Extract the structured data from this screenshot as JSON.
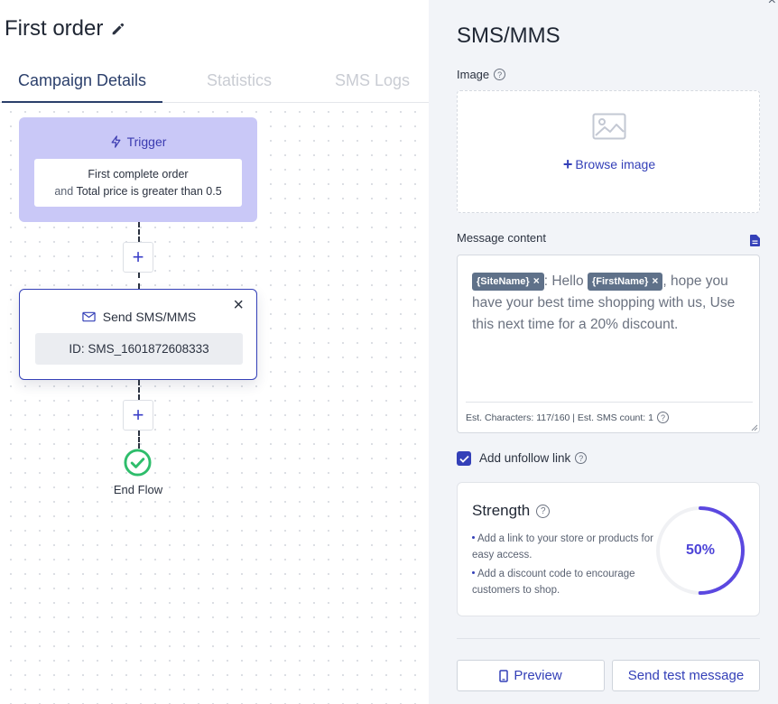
{
  "left": {
    "title": "First order",
    "tabs": [
      {
        "label": "Campaign Details",
        "active": true
      },
      {
        "label": "Statistics",
        "active": false
      },
      {
        "label": "SMS Logs",
        "active": false
      }
    ]
  },
  "flow": {
    "trigger": {
      "title": "Trigger",
      "line1": "First complete order",
      "line2_prefix": "and",
      "line2": "Total price is greater than 0.5"
    },
    "plus_label": "+",
    "sms_node": {
      "title": "Send SMS/MMS",
      "id_text": "ID: SMS_1601872608333",
      "close_label": "×"
    },
    "end": {
      "label": "End Flow"
    }
  },
  "panel": {
    "title": "SMS/MMS",
    "corner_close": "×",
    "image_label": "Image",
    "browse_label": "Browse image",
    "browse_plus": "+",
    "message_label": "Message content",
    "message": {
      "tag1": "{SiteName}",
      "text1": ": Hello",
      "tag2": "{FirstName}",
      "text2": ", hope you have your best time shopping with us, Use this  next time for a 20% discount.",
      "tag_remove": "×"
    },
    "est_text": "Est. Characters: 117/160 | Est. SMS count: 1",
    "unfollow_label": "Add unfollow link",
    "unfollow_checked": true,
    "help_glyph": "?",
    "strength": {
      "title": "Strength",
      "tips": [
        "Add a link to your store or products for easy access.",
        "Add a discount code to encourage customers to shop."
      ],
      "value_percent": 50,
      "value_label": "50%"
    },
    "buttons": {
      "preview": "Preview",
      "send_test": "Send test message"
    }
  },
  "colors": {
    "accent": "#3440b8",
    "trigger_bg": "#c9c8f7",
    "gauge": "#5b48e0",
    "success": "#2ebd6b"
  }
}
